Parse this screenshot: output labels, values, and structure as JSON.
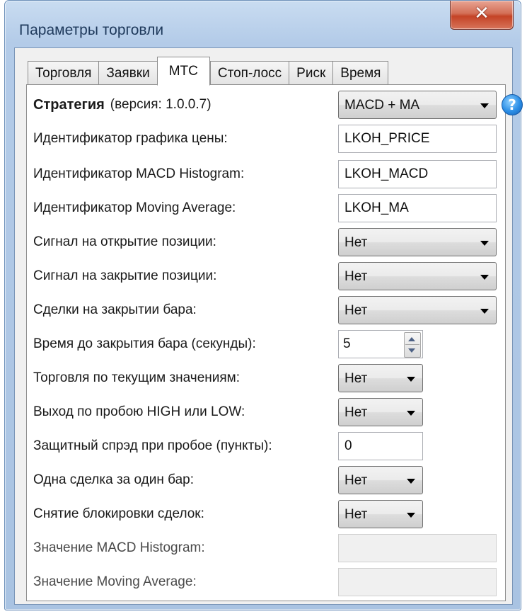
{
  "window": {
    "title": "Параметры торговли",
    "close_glyph": "✕"
  },
  "tabs": [
    {
      "label": "Торговля"
    },
    {
      "label": "Заявки"
    },
    {
      "label": "МТС",
      "active": true
    },
    {
      "label": "Стоп-лосс"
    },
    {
      "label": "Риск"
    },
    {
      "label": "Время"
    }
  ],
  "strategy": {
    "label": "Стратегия",
    "version_text": "(версия: 1.0.0.7)",
    "selected": "MACD + MA",
    "help_glyph": "?"
  },
  "fields": {
    "price_chart_id": {
      "label": "Идентификатор графика цены:",
      "value": "LKOH_PRICE"
    },
    "macd_id": {
      "label": "Идентификатор MACD Histogram:",
      "value": "LKOH_MACD"
    },
    "ma_id": {
      "label": "Идентификатор Moving Average:",
      "value": "LKOH_MA"
    },
    "open_signal": {
      "label": "Сигнал на открытие позиции:",
      "value": "Нет"
    },
    "close_signal": {
      "label": "Сигнал на закрытие позиции:",
      "value": "Нет"
    },
    "bar_close_trades": {
      "label": "Сделки на закрытии бара:",
      "value": "Нет"
    },
    "time_to_bar_close": {
      "label": "Время до закрытия бара (секунды):",
      "value": "5"
    },
    "trade_current_values": {
      "label": "Торговля по текущим значениям:",
      "value": "Нет"
    },
    "exit_breakout": {
      "label": "Выход по пробою HIGH или LOW:",
      "value": "Нет"
    },
    "protective_spread": {
      "label": "Защитный спрэд при пробое (пункты):",
      "value": "0"
    },
    "one_trade_per_bar": {
      "label": "Одна сделка за один бар:",
      "value": "Нет"
    },
    "unblock_trades": {
      "label": "Снятие блокировки сделок:",
      "value": "Нет"
    },
    "macd_value": {
      "label": "Значение MACD Histogram:",
      "value": ""
    },
    "ma_value": {
      "label": "Значение Moving Average:",
      "value": ""
    }
  }
}
